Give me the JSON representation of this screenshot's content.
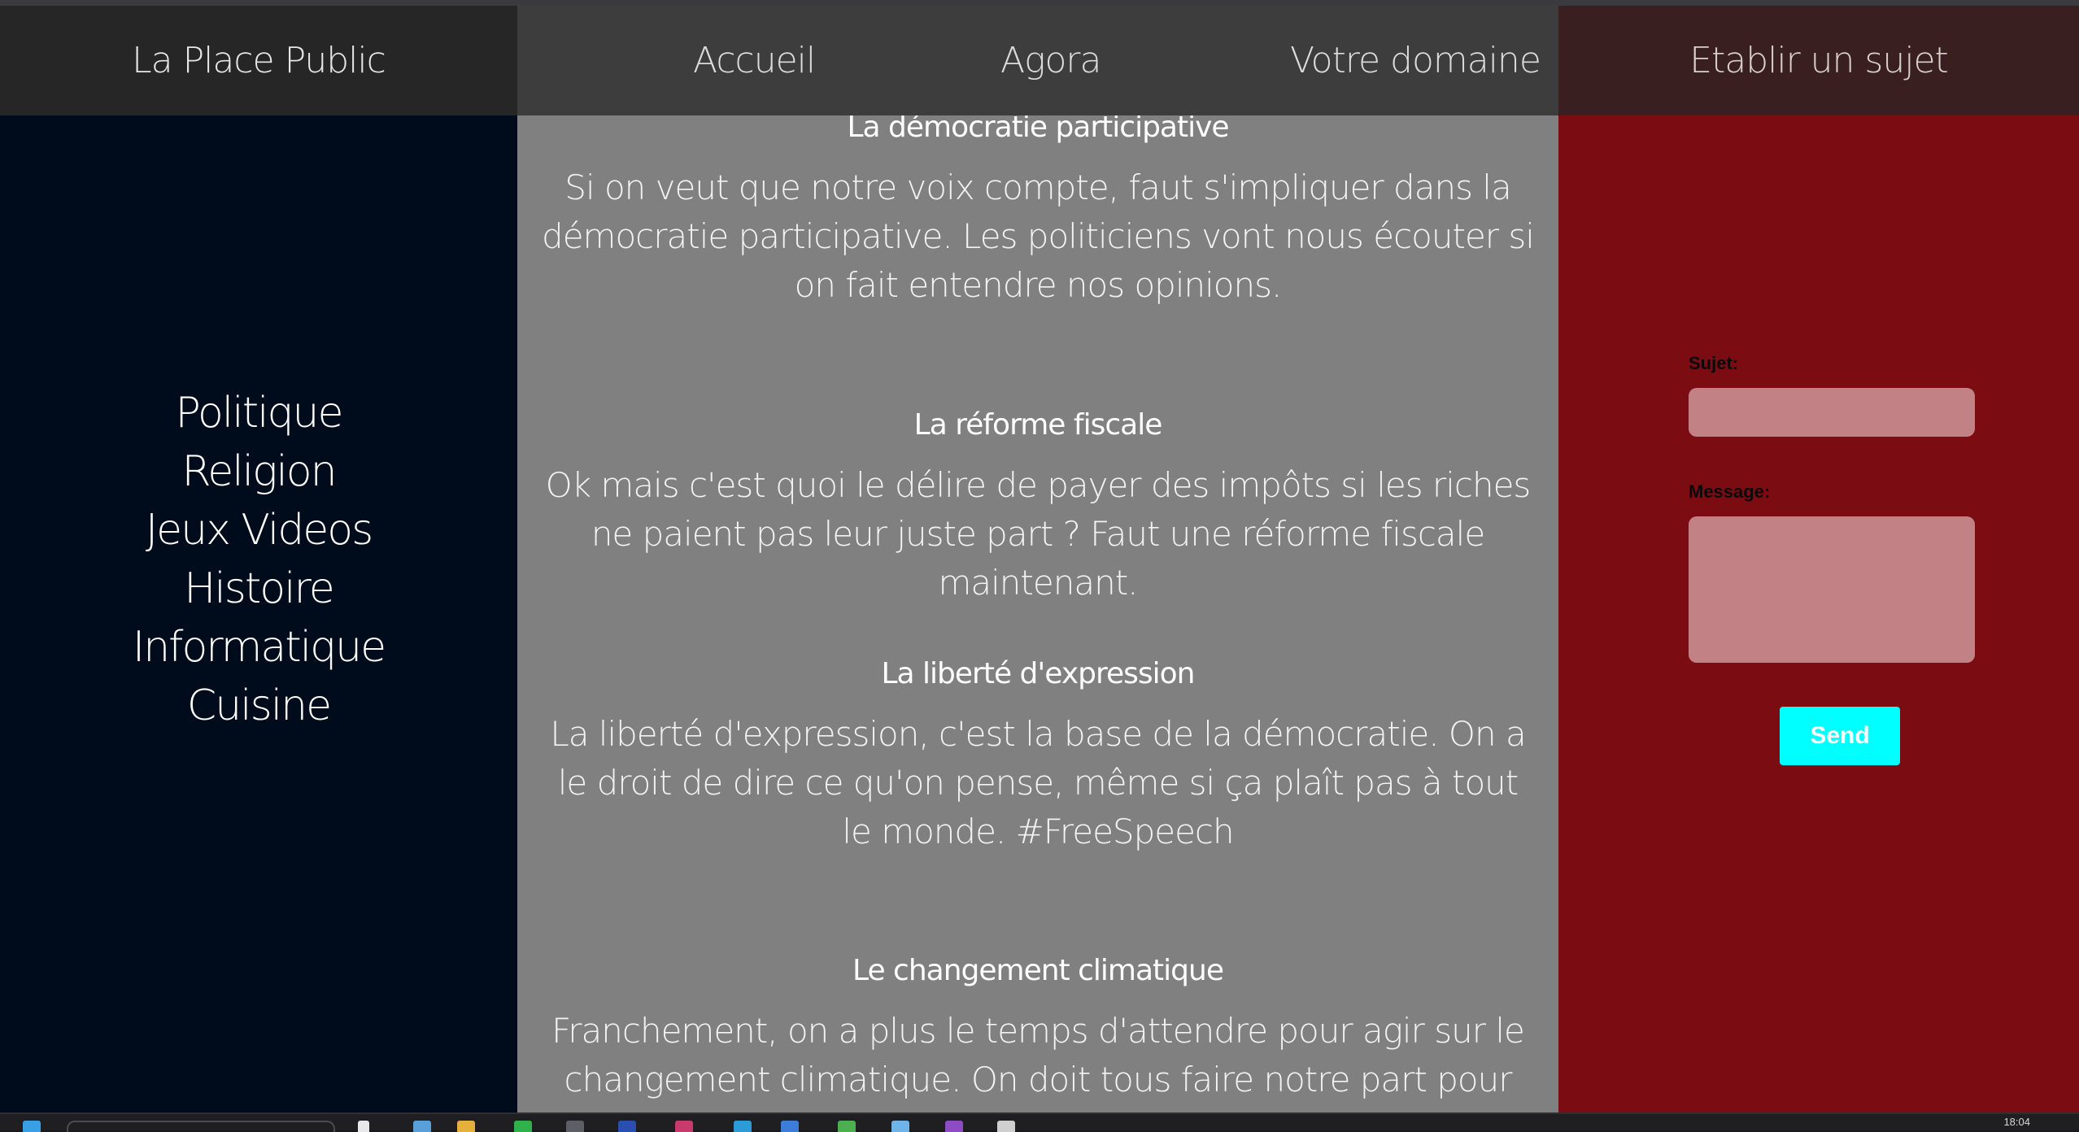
{
  "header": {
    "site_title": "La Place Public",
    "nav": [
      "Accueil",
      "Agora",
      "Votre domaine"
    ],
    "create_topic_label": "Etablir un sujet"
  },
  "sidebar": {
    "categories": [
      "Politique",
      "Religion",
      "Jeux Videos",
      "Histoire",
      "Informatique",
      "Cuisine"
    ]
  },
  "posts": [
    {
      "title": "La démocratie participative",
      "body": "Si on veut que notre voix compte, faut s'impliquer dans la démocratie participative. Les politiciens vont nous écouter si on fait entendre nos opinions."
    },
    {
      "title": "La réforme fiscale",
      "body": "Ok mais c'est quoi le délire de payer des impôts si les riches ne paient pas leur juste part ? Faut une réforme fiscale maintenant."
    },
    {
      "title": "La liberté d'expression",
      "body": "La liberté d'expression, c'est la base de la démocratie. On a le droit de dire ce qu'on pense, même si ça plaît pas à tout le monde. #FreeSpeech"
    },
    {
      "title": "Le changement climatique",
      "body": "Franchement, on a plus le temps d'attendre pour agir sur le changement climatique. On doit tous faire notre part pour sauver la"
    }
  ],
  "form": {
    "subject_label": "Sujet:",
    "message_label": "Message:",
    "subject_value": "",
    "message_value": "",
    "send_label": "Send"
  },
  "taskbar": {
    "clock": "18:04"
  },
  "colors": {
    "header_brand_bg": "#262626",
    "header_nav_bg": "#3d3d3d",
    "header_create_bg": "#3a1f20",
    "sidebar_bg": "#000c1b",
    "feed_bg": "#808080",
    "form_bg": "#7b0c12",
    "field_bg": "#c28184",
    "send_button_bg": "#00ffff"
  }
}
